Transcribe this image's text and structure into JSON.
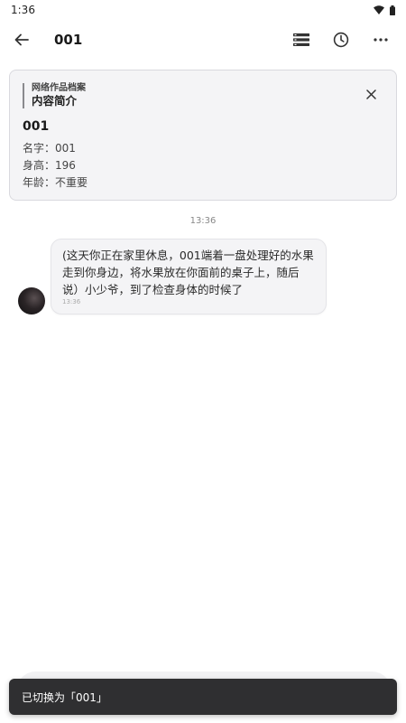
{
  "status_bar": {
    "time": "1:36"
  },
  "app_bar": {
    "title": "001"
  },
  "intro_card": {
    "subtitle": "网络作品档案",
    "title": "内容简介",
    "character_name": "001",
    "attributes": [
      "名字：001",
      "身高：196",
      "年龄：不重要"
    ]
  },
  "chat": {
    "timestamp": "13:36",
    "messages": [
      {
        "text": "(这天你正在家里休息，001端着一盘处理好的水果走到你身边，将水果放在你面前的桌子上，随后说）小少爷，到了检查身体的时候了",
        "time": "13:36"
      }
    ]
  },
  "toast": {
    "text": "已切换为「001」"
  },
  "icons": {
    "back": "back-arrow-icon",
    "list": "list-icon",
    "history": "clock-icon",
    "more": "more-icon",
    "close": "close-icon",
    "wifi": "wifi-icon",
    "battery": "battery-icon"
  },
  "colors": {
    "toast_bg": "#2f2f31",
    "card_bg": "#f4f4f6",
    "bubble_bg": "#f4f4f6"
  }
}
